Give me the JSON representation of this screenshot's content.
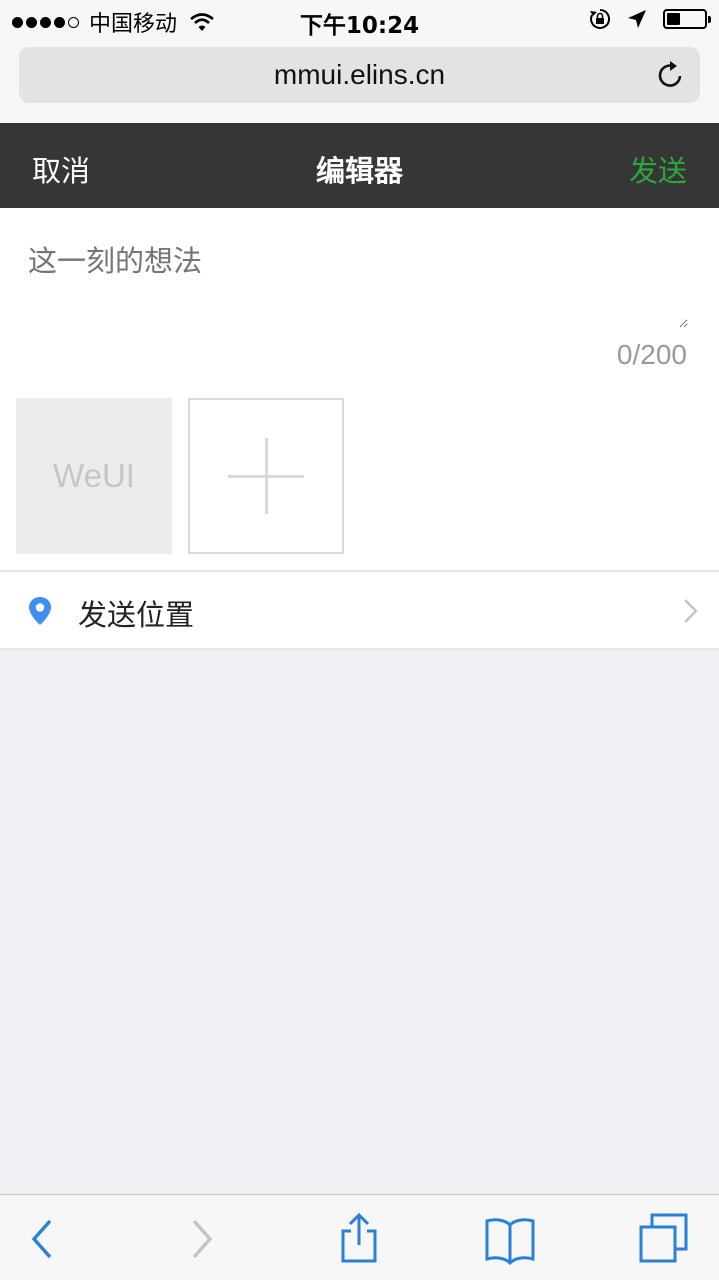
{
  "status_bar": {
    "carrier": "中国移动",
    "time": "下午10:24",
    "battery_level": 0.35,
    "icons": [
      "signal-dots",
      "wifi-icon",
      "rotation-lock-icon",
      "location-arrow-icon",
      "battery-icon"
    ]
  },
  "address_bar": {
    "url": "mmui.elins.cn",
    "reload_icon": "reload-icon"
  },
  "nav_bar": {
    "cancel_label": "取消",
    "title": "编辑器",
    "send_label": "发送",
    "send_color": "#2ea73a",
    "background": "#363636"
  },
  "editor": {
    "placeholder": "这一刻的想法",
    "value": "",
    "counter": "0/200",
    "thumbnail_label": "WeUI",
    "add_icon": "plus-icon"
  },
  "location": {
    "label": "发送位置",
    "icon": "location-pin-icon",
    "icon_color": "#3e8ef5",
    "arrow": "chevron-right-icon"
  },
  "toolbar": {
    "accent": "#2a7fd8",
    "items": [
      "back-icon",
      "forward-icon",
      "share-icon",
      "bookmarks-icon",
      "tabs-icon"
    ],
    "forward_enabled": false
  }
}
